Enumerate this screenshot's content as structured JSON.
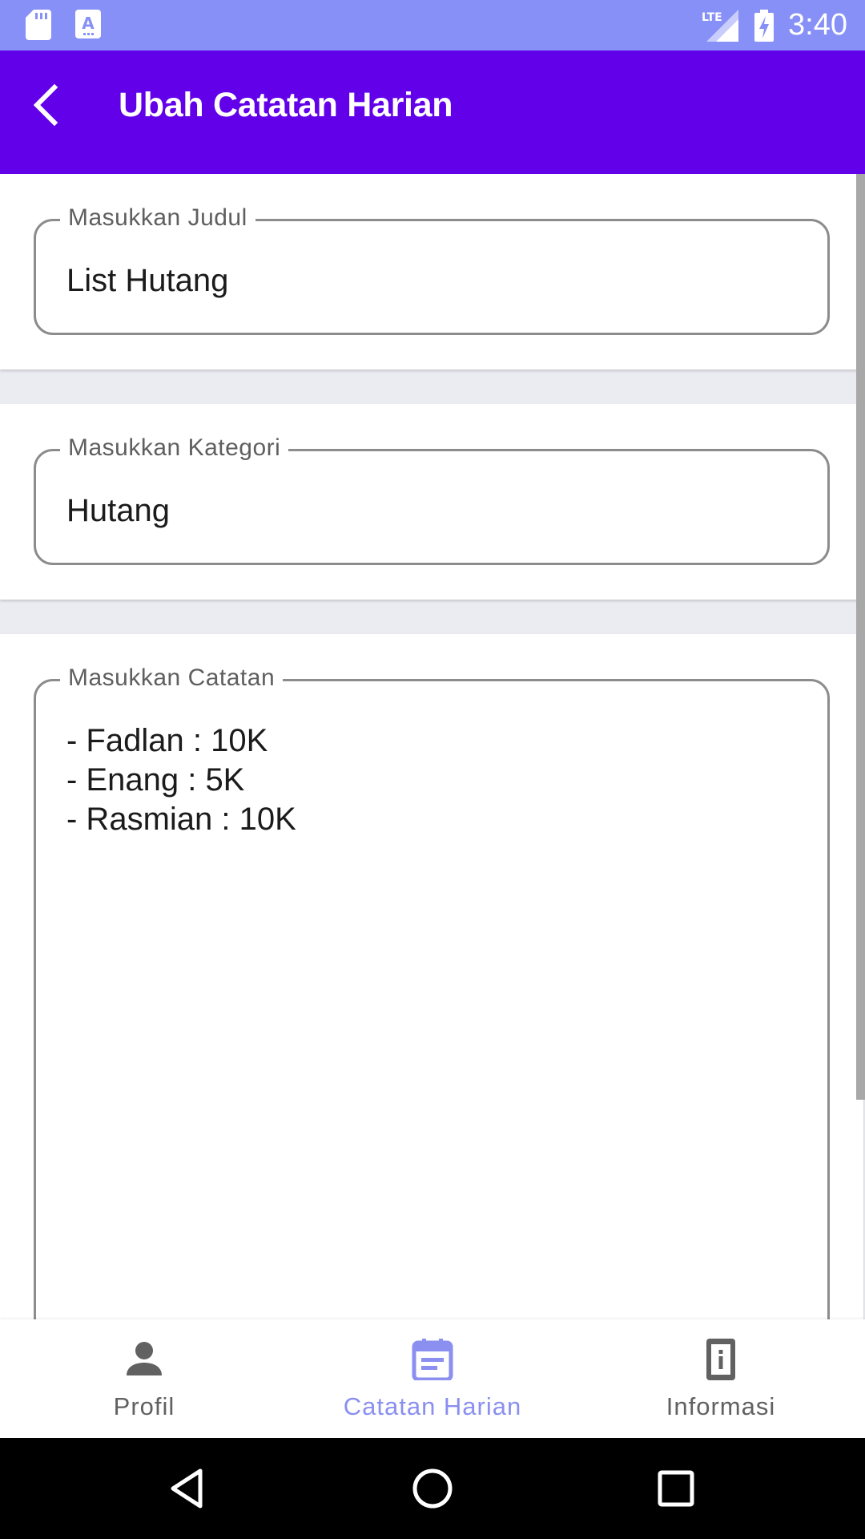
{
  "status_bar": {
    "time": "3:40",
    "network": "LTE",
    "icons": [
      "sd-card-icon",
      "keyboard-a-icon",
      "lte-signal-icon",
      "battery-charging-icon"
    ]
  },
  "app_bar": {
    "title": "Ubah Catatan Harian",
    "back_icon": "chevron-left-icon"
  },
  "form": {
    "title_field": {
      "label": "Masukkan Judul",
      "value": "List Hutang"
    },
    "category_field": {
      "label": "Masukkan Kategori",
      "value": "Hutang"
    },
    "notes_field": {
      "label": "Masukkan Catatan",
      "value": "- Fadlan : 10K\n- Enang : 5K\n- Rasmian : 10K"
    }
  },
  "bottom_nav": {
    "items": [
      {
        "label": "Profil",
        "icon": "person-icon",
        "active": false
      },
      {
        "label": "Catatan Harian",
        "icon": "calendar-note-icon",
        "active": true
      },
      {
        "label": "Informasi",
        "icon": "info-device-icon",
        "active": false
      }
    ]
  },
  "colors": {
    "app_bar": "#6200ea",
    "status_bar": "#8690f6",
    "active_nav": "#8a8ff0",
    "inactive_nav": "#616161",
    "background": "#ebebf2"
  }
}
